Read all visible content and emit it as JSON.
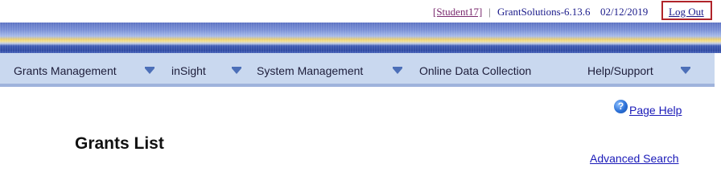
{
  "header": {
    "user_link": "[Student17]",
    "separator": "|",
    "app_version": "GrantSolutions-6.13.6",
    "date": "02/12/2019",
    "logout_label": "Log Out"
  },
  "nav": {
    "items": [
      {
        "label": "Grants Management",
        "has_dropdown": true
      },
      {
        "label": "inSight",
        "has_dropdown": true
      },
      {
        "label": "System Management",
        "has_dropdown": true
      },
      {
        "label": "Online Data Collection",
        "has_dropdown": false
      },
      {
        "label": "Help/Support",
        "has_dropdown": true
      }
    ],
    "dropdown_icon": "chevron-down-icon"
  },
  "main": {
    "help_icon": "question-icon",
    "help_icon_glyph": "?",
    "page_help_label": "Page Help",
    "title": "Grants List",
    "advanced_search_label": "Advanced Search"
  },
  "colors": {
    "link": "#1a1ab8",
    "user_link": "#7a2a6e",
    "nav_background": "#c9d8ef",
    "highlight_border": "#b0242a"
  }
}
